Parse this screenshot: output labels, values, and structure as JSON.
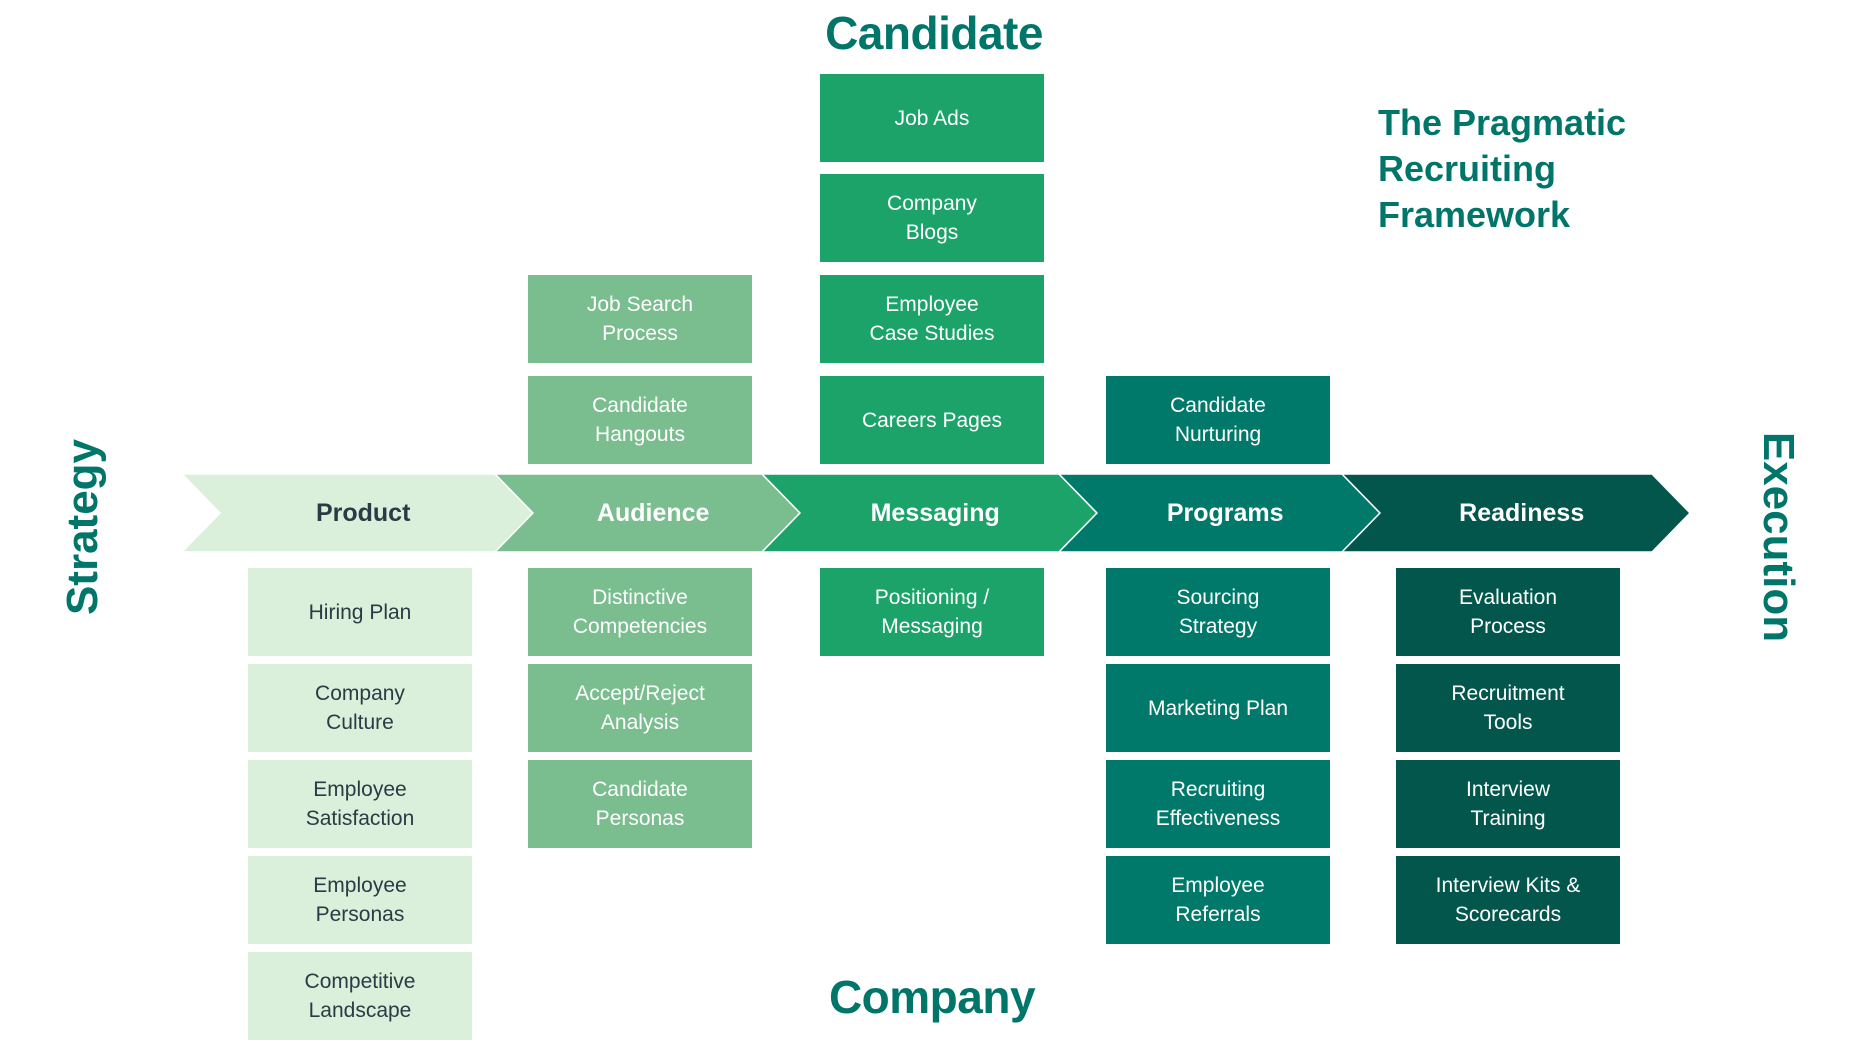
{
  "title": "The Pragmatic Recruiting Framework",
  "title_lines": [
    "The Pragmatic",
    "Recruiting",
    "Framework"
  ],
  "axis_labels": {
    "top": "Candidate",
    "bottom": "Company",
    "left": "Strategy",
    "right": "Execution"
  },
  "colors": {
    "heading": "#00756A",
    "product": "#DAF0DA",
    "audience": "#7ABD8E",
    "messaging": "#1BA36A",
    "programs": "#00796A",
    "readiness": "#02564C",
    "dark_text": "#2D3A45"
  },
  "stages": [
    {
      "name": "Product",
      "color": "#DAF0DA",
      "text_color": "#2D3A45",
      "above": [],
      "below": [
        "Hiring Plan",
        "Company\nCulture",
        "Employee\nSatisfaction",
        "Employee\nPersonas",
        "Competitive\nLandscape"
      ]
    },
    {
      "name": "Audience",
      "color": "#7ABD8E",
      "text_color": "#FFFFFF",
      "above": [
        "Job Search\nProcess",
        "Candidate\nHangouts"
      ],
      "below": [
        "Distinctive\nCompetencies",
        "Accept/Reject\nAnalysis",
        "Candidate\nPersonas"
      ]
    },
    {
      "name": "Messaging",
      "color": "#1BA36A",
      "text_color": "#FFFFFF",
      "above": [
        "Job Ads",
        "Company\nBlogs",
        "Employee\nCase Studies",
        "Careers Pages"
      ],
      "below": [
        "Positioning /\nMessaging"
      ]
    },
    {
      "name": "Programs",
      "color": "#00796A",
      "text_color": "#FFFFFF",
      "above": [
        "Candidate\nNurturing"
      ],
      "below": [
        "Sourcing\nStrategy",
        "Marketing Plan",
        "Recruiting\nEffectiveness",
        "Employee\nReferrals"
      ]
    },
    {
      "name": "Readiness",
      "color": "#02564C",
      "text_color": "#FFFFFF",
      "above": [],
      "below": [
        "Evaluation\nProcess",
        "Recruitment\nTools",
        "Interview\nTraining",
        "Interview Kits &\nScorecards"
      ]
    }
  ]
}
